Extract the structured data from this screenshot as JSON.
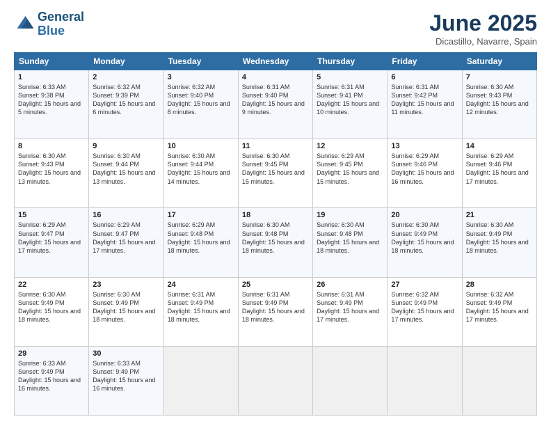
{
  "brand": {
    "name_part1": "General",
    "name_part2": "Blue"
  },
  "title": "June 2025",
  "subtitle": "Dicastillo, Navarre, Spain",
  "days_of_week": [
    "Sunday",
    "Monday",
    "Tuesday",
    "Wednesday",
    "Thursday",
    "Friday",
    "Saturday"
  ],
  "weeks": [
    [
      {
        "day": "1",
        "rise": "6:33 AM",
        "set": "9:38 PM",
        "daylight": "15 hours and 5 minutes."
      },
      {
        "day": "2",
        "rise": "6:32 AM",
        "set": "9:39 PM",
        "daylight": "15 hours and 6 minutes."
      },
      {
        "day": "3",
        "rise": "6:32 AM",
        "set": "9:40 PM",
        "daylight": "15 hours and 8 minutes."
      },
      {
        "day": "4",
        "rise": "6:31 AM",
        "set": "9:40 PM",
        "daylight": "15 hours and 9 minutes."
      },
      {
        "day": "5",
        "rise": "6:31 AM",
        "set": "9:41 PM",
        "daylight": "15 hours and 10 minutes."
      },
      {
        "day": "6",
        "rise": "6:31 AM",
        "set": "9:42 PM",
        "daylight": "15 hours and 11 minutes."
      },
      {
        "day": "7",
        "rise": "6:30 AM",
        "set": "9:43 PM",
        "daylight": "15 hours and 12 minutes."
      }
    ],
    [
      {
        "day": "8",
        "rise": "6:30 AM",
        "set": "9:43 PM",
        "daylight": "15 hours and 13 minutes."
      },
      {
        "day": "9",
        "rise": "6:30 AM",
        "set": "9:44 PM",
        "daylight": "15 hours and 13 minutes."
      },
      {
        "day": "10",
        "rise": "6:30 AM",
        "set": "9:44 PM",
        "daylight": "15 hours and 14 minutes."
      },
      {
        "day": "11",
        "rise": "6:30 AM",
        "set": "9:45 PM",
        "daylight": "15 hours and 15 minutes."
      },
      {
        "day": "12",
        "rise": "6:29 AM",
        "set": "9:45 PM",
        "daylight": "15 hours and 15 minutes."
      },
      {
        "day": "13",
        "rise": "6:29 AM",
        "set": "9:46 PM",
        "daylight": "15 hours and 16 minutes."
      },
      {
        "day": "14",
        "rise": "6:29 AM",
        "set": "9:46 PM",
        "daylight": "15 hours and 17 minutes."
      }
    ],
    [
      {
        "day": "15",
        "rise": "6:29 AM",
        "set": "9:47 PM",
        "daylight": "15 hours and 17 minutes."
      },
      {
        "day": "16",
        "rise": "6:29 AM",
        "set": "9:47 PM",
        "daylight": "15 hours and 17 minutes."
      },
      {
        "day": "17",
        "rise": "6:29 AM",
        "set": "9:48 PM",
        "daylight": "15 hours and 18 minutes."
      },
      {
        "day": "18",
        "rise": "6:30 AM",
        "set": "9:48 PM",
        "daylight": "15 hours and 18 minutes."
      },
      {
        "day": "19",
        "rise": "6:30 AM",
        "set": "9:48 PM",
        "daylight": "15 hours and 18 minutes."
      },
      {
        "day": "20",
        "rise": "6:30 AM",
        "set": "9:49 PM",
        "daylight": "15 hours and 18 minutes."
      },
      {
        "day": "21",
        "rise": "6:30 AM",
        "set": "9:49 PM",
        "daylight": "15 hours and 18 minutes."
      }
    ],
    [
      {
        "day": "22",
        "rise": "6:30 AM",
        "set": "9:49 PM",
        "daylight": "15 hours and 18 minutes."
      },
      {
        "day": "23",
        "rise": "6:30 AM",
        "set": "9:49 PM",
        "daylight": "15 hours and 18 minutes."
      },
      {
        "day": "24",
        "rise": "6:31 AM",
        "set": "9:49 PM",
        "daylight": "15 hours and 18 minutes."
      },
      {
        "day": "25",
        "rise": "6:31 AM",
        "set": "9:49 PM",
        "daylight": "15 hours and 18 minutes."
      },
      {
        "day": "26",
        "rise": "6:31 AM",
        "set": "9:49 PM",
        "daylight": "15 hours and 17 minutes."
      },
      {
        "day": "27",
        "rise": "6:32 AM",
        "set": "9:49 PM",
        "daylight": "15 hours and 17 minutes."
      },
      {
        "day": "28",
        "rise": "6:32 AM",
        "set": "9:49 PM",
        "daylight": "15 hours and 17 minutes."
      }
    ],
    [
      {
        "day": "29",
        "rise": "6:33 AM",
        "set": "9:49 PM",
        "daylight": "15 hours and 16 minutes."
      },
      {
        "day": "30",
        "rise": "6:33 AM",
        "set": "9:49 PM",
        "daylight": "15 hours and 16 minutes."
      },
      null,
      null,
      null,
      null,
      null
    ]
  ]
}
